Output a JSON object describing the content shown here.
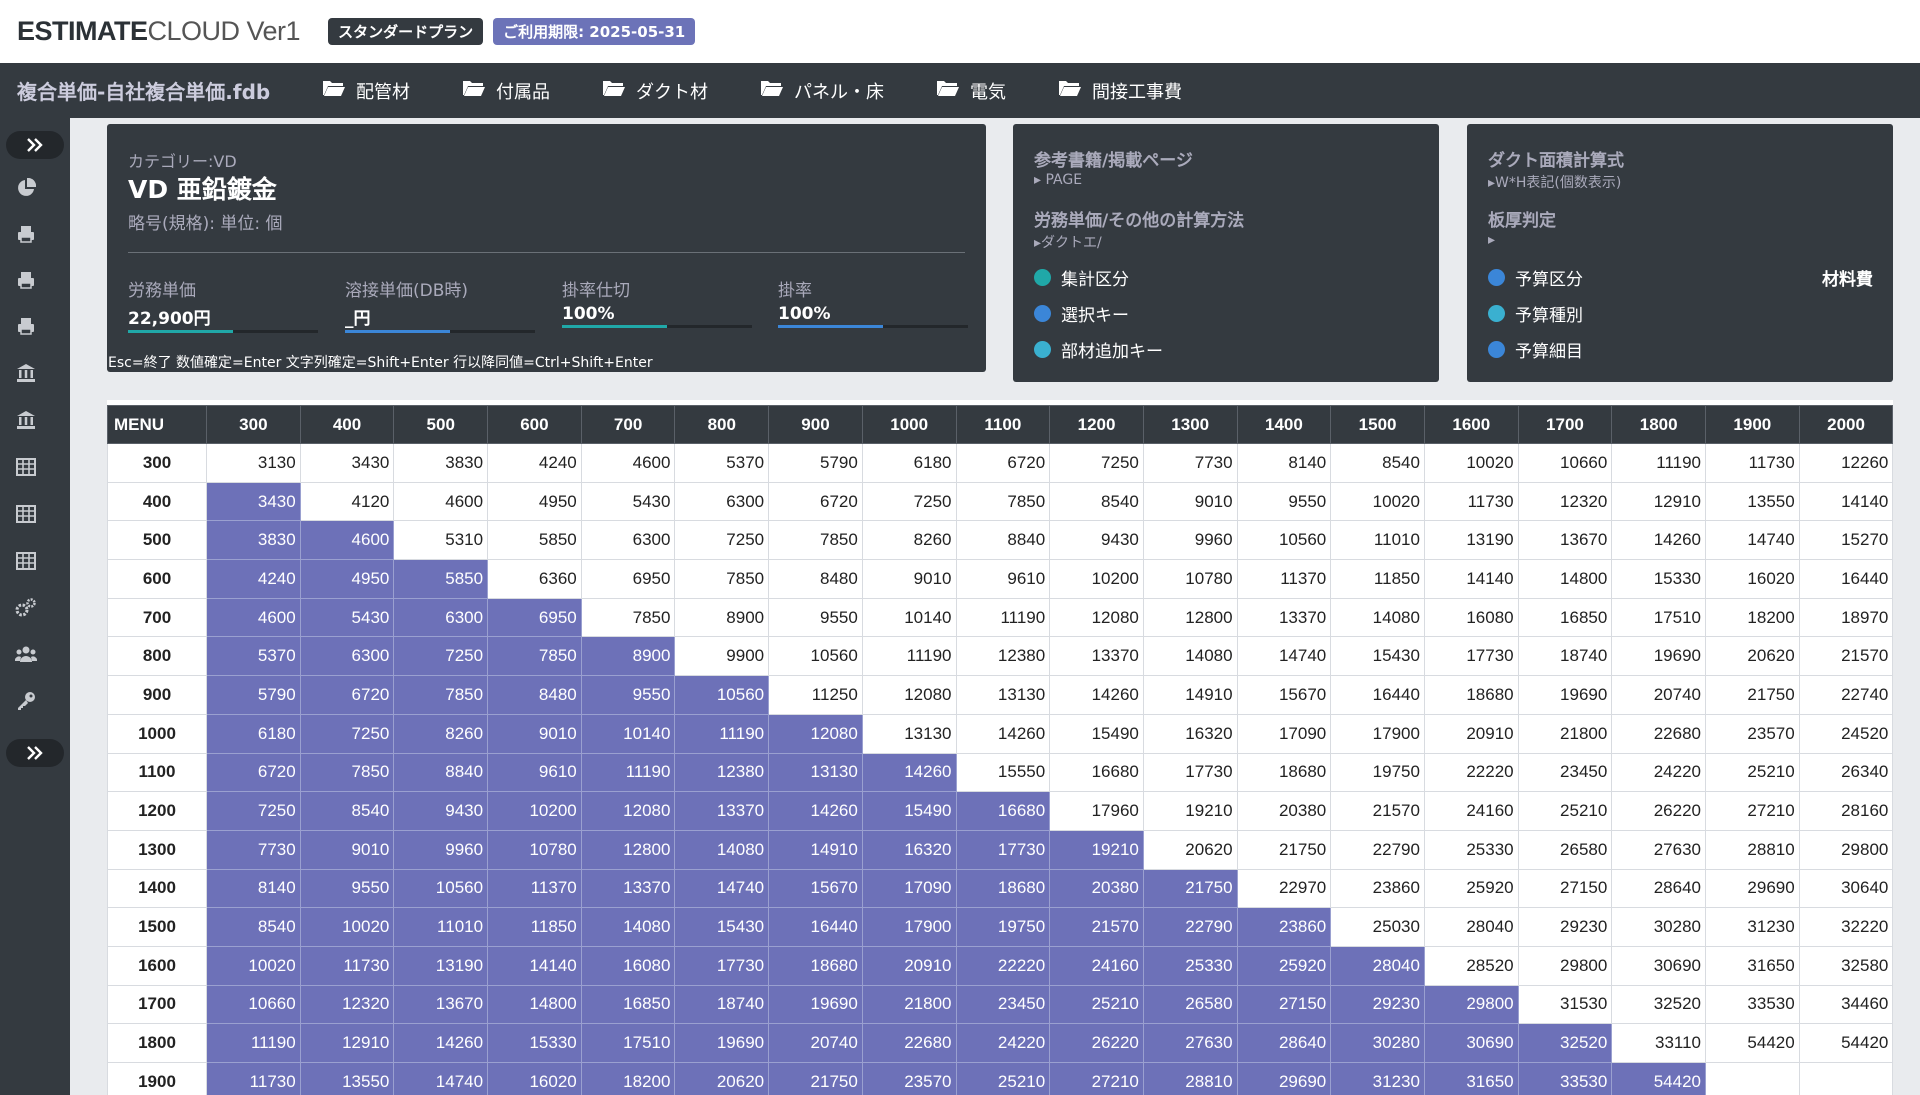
{
  "app": {
    "brand_bold": "ESTIMATE",
    "brand_light": "CLOUD Ver1",
    "plan_badge": "スタンダードプラン",
    "expiry_badge": "ご利用期限: 2025-05-31"
  },
  "nav": {
    "filename": "複合単価-自社複合単価.fdb",
    "items": [
      {
        "label": "配管材",
        "icon": "folder-open-icon"
      },
      {
        "label": "付属品",
        "icon": "folder-open-icon"
      },
      {
        "label": "ダクト材",
        "icon": "folder-open-icon"
      },
      {
        "label": "パネル・床",
        "icon": "folder-open-icon"
      },
      {
        "label": "電気",
        "icon": "folder-open-icon"
      },
      {
        "label": "間接工事費",
        "icon": "folder-open-icon"
      }
    ]
  },
  "sidebar": {
    "icons": [
      "expand-icon",
      "pie-chart-icon",
      "printer-icon",
      "printer-icon",
      "printer-icon",
      "bank-icon",
      "bank-icon",
      "table-icon",
      "table-icon",
      "table-icon",
      "gears-icon",
      "users-icon",
      "key-icon",
      "expand-icon"
    ]
  },
  "item": {
    "category": "カテゴリー:VD",
    "title": "VD 亜鉛鍍金",
    "subtitle": "略号(規格): 単位: 個",
    "fields": [
      {
        "label": "労務単価",
        "value": "22,900円"
      },
      {
        "label": "溶接単価(DB時)",
        "value": "_円"
      },
      {
        "label": "掛率仕切",
        "value": "100%"
      },
      {
        "label": "掛率",
        "value": "100%"
      }
    ],
    "hint": "Esc=終了 数値確定=Enter 文字列確定=Shift+Enter 行以降同値=Ctrl+Shift+Enter"
  },
  "reference": {
    "title1": "参考書籍/掲載ページ",
    "sub1": "PAGE",
    "title2": "労務単価/その他の計算方法",
    "sub2": "▸ダクトエ/",
    "rows": [
      {
        "label": "集計区分",
        "color": "#20a8a8"
      },
      {
        "label": "選択キー",
        "color": "#3b86d8"
      },
      {
        "label": "部材追加キー",
        "color": "#3ab0d0"
      }
    ]
  },
  "duct": {
    "title1": "ダクト面積計算式",
    "sub1": "▸W*H表記(個数表示)",
    "title2": "板厚判定",
    "sub2": "▸",
    "rows": [
      {
        "label": "予算区分",
        "color": "#3b86d8"
      },
      {
        "label": "予算種別",
        "color": "#3ab0d0"
      },
      {
        "label": "予算細目",
        "color": "#3b86d8"
      }
    ],
    "material_label": "材料費"
  },
  "table": {
    "corner": "MENU",
    "columns": [
      "300",
      "400",
      "500",
      "600",
      "700",
      "800",
      "900",
      "1000",
      "1100",
      "1200",
      "1300",
      "1400",
      "1500",
      "1600",
      "1700",
      "1800",
      "1900",
      "2000"
    ],
    "rows": [
      {
        "h": "300",
        "v": [
          "3130",
          "3430",
          "3830",
          "4240",
          "4600",
          "5370",
          "5790",
          "6180",
          "6720",
          "7250",
          "7730",
          "8140",
          "8540",
          "10020",
          "10660",
          "11190",
          "11730",
          "12260"
        ]
      },
      {
        "h": "400",
        "v": [
          "3430",
          "4120",
          "4600",
          "4950",
          "5430",
          "6300",
          "6720",
          "7250",
          "7850",
          "8540",
          "9010",
          "9550",
          "10020",
          "11730",
          "12320",
          "12910",
          "13550",
          "14140"
        ]
      },
      {
        "h": "500",
        "v": [
          "3830",
          "4600",
          "5310",
          "5850",
          "6300",
          "7250",
          "7850",
          "8260",
          "8840",
          "9430",
          "9960",
          "10560",
          "11010",
          "13190",
          "13670",
          "14260",
          "14740",
          "15270"
        ]
      },
      {
        "h": "600",
        "v": [
          "4240",
          "4950",
          "5850",
          "6360",
          "6950",
          "7850",
          "8480",
          "9010",
          "9610",
          "10200",
          "10780",
          "11370",
          "11850",
          "14140",
          "14800",
          "15330",
          "16020",
          "16440"
        ]
      },
      {
        "h": "700",
        "v": [
          "4600",
          "5430",
          "6300",
          "6950",
          "7850",
          "8900",
          "9550",
          "10140",
          "11190",
          "12080",
          "12800",
          "13370",
          "14080",
          "16080",
          "16850",
          "17510",
          "18200",
          "18970"
        ]
      },
      {
        "h": "800",
        "v": [
          "5370",
          "6300",
          "7250",
          "7850",
          "8900",
          "9900",
          "10560",
          "11190",
          "12380",
          "13370",
          "14080",
          "14740",
          "15430",
          "17730",
          "18740",
          "19690",
          "20620",
          "21570"
        ]
      },
      {
        "h": "900",
        "v": [
          "5790",
          "6720",
          "7850",
          "8480",
          "9550",
          "10560",
          "11250",
          "12080",
          "13130",
          "14260",
          "14910",
          "15670",
          "16440",
          "18680",
          "19690",
          "20740",
          "21750",
          "22740"
        ]
      },
      {
        "h": "1000",
        "v": [
          "6180",
          "7250",
          "8260",
          "9010",
          "10140",
          "11190",
          "12080",
          "13130",
          "14260",
          "15490",
          "16320",
          "17090",
          "17900",
          "20910",
          "21800",
          "22680",
          "23570",
          "24520"
        ]
      },
      {
        "h": "1100",
        "v": [
          "6720",
          "7850",
          "8840",
          "9610",
          "11190",
          "12380",
          "13130",
          "14260",
          "15550",
          "16680",
          "17730",
          "18680",
          "19750",
          "22220",
          "23450",
          "24220",
          "25210",
          "26340"
        ]
      },
      {
        "h": "1200",
        "v": [
          "7250",
          "8540",
          "9430",
          "10200",
          "12080",
          "13370",
          "14260",
          "15490",
          "16680",
          "17960",
          "19210",
          "20380",
          "21570",
          "24160",
          "25210",
          "26220",
          "27210",
          "28160"
        ]
      },
      {
        "h": "1300",
        "v": [
          "7730",
          "9010",
          "9960",
          "10780",
          "12800",
          "14080",
          "14910",
          "16320",
          "17730",
          "19210",
          "20620",
          "21750",
          "22790",
          "25330",
          "26580",
          "27630",
          "28810",
          "29800"
        ]
      },
      {
        "h": "1400",
        "v": [
          "8140",
          "9550",
          "10560",
          "11370",
          "13370",
          "14740",
          "15670",
          "17090",
          "18680",
          "20380",
          "21750",
          "22970",
          "23860",
          "25920",
          "27150",
          "28640",
          "29690",
          "30640"
        ]
      },
      {
        "h": "1500",
        "v": [
          "8540",
          "10020",
          "11010",
          "11850",
          "14080",
          "15430",
          "16440",
          "17900",
          "19750",
          "21570",
          "22790",
          "23860",
          "25030",
          "28040",
          "29230",
          "30280",
          "31230",
          "32220"
        ]
      },
      {
        "h": "1600",
        "v": [
          "10020",
          "11730",
          "13190",
          "14140",
          "16080",
          "17730",
          "18680",
          "20910",
          "22220",
          "24160",
          "25330",
          "25920",
          "28040",
          "28520",
          "29800",
          "30690",
          "31650",
          "32580"
        ]
      },
      {
        "h": "1700",
        "v": [
          "10660",
          "12320",
          "13670",
          "14800",
          "16850",
          "18740",
          "19690",
          "21800",
          "23450",
          "25210",
          "26580",
          "27150",
          "29230",
          "29800",
          "31530",
          "32520",
          "33530",
          "34460"
        ]
      },
      {
        "h": "1800",
        "v": [
          "11190",
          "12910",
          "14260",
          "15330",
          "17510",
          "19690",
          "20740",
          "22680",
          "24220",
          "26220",
          "27630",
          "28640",
          "30280",
          "30690",
          "32520",
          "33110",
          "54420",
          "54420"
        ]
      },
      {
        "h": "1900",
        "v": [
          "11730",
          "13550",
          "14740",
          "16020",
          "18200",
          "20620",
          "21750",
          "23570",
          "25210",
          "27210",
          "28810",
          "29690",
          "31230",
          "31650",
          "33530",
          "54420",
          "",
          ""
        ]
      }
    ]
  }
}
